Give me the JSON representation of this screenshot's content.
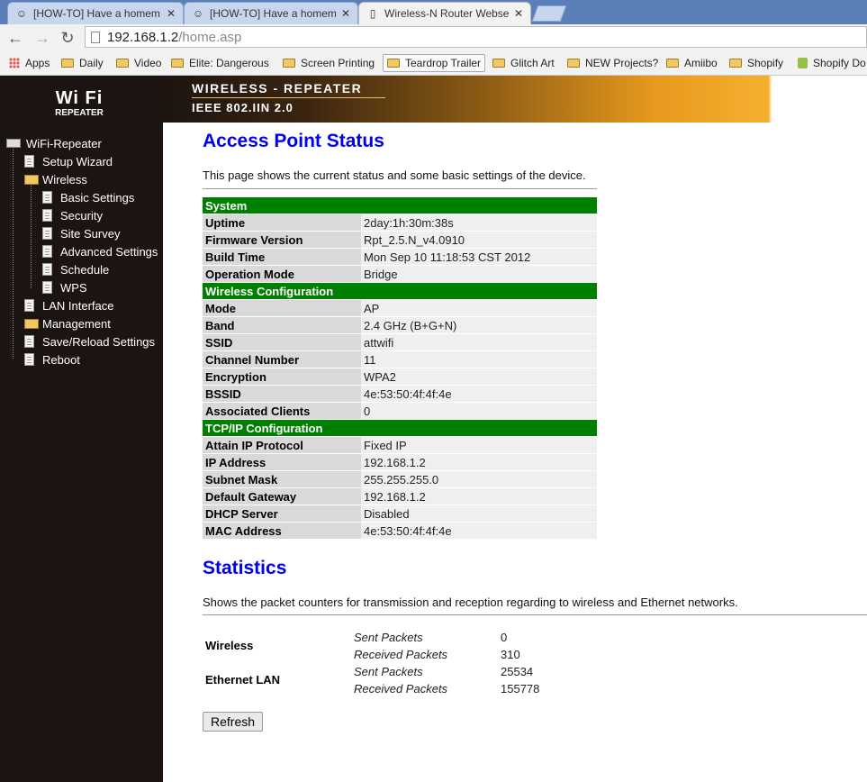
{
  "browser": {
    "tabs": [
      {
        "title": "[HOW-TO] Have a homem",
        "active": false
      },
      {
        "title": "[HOW-TO] Have a homem",
        "active": false
      },
      {
        "title": "Wireless-N Router Webse",
        "active": true
      }
    ],
    "url_host": "192.168.1.2",
    "url_path": "/home.asp",
    "bookmarks": [
      "Apps",
      "Daily",
      "Video",
      "Elite: Dangerous",
      "Screen Printing",
      "Teardrop Trailer",
      "Glitch Art",
      "NEW Projects?",
      "Amiibo",
      "Shopify",
      "Shopify Do"
    ]
  },
  "banner": {
    "logo_wifi": "Wi Fi",
    "logo_sub": "REPEATER",
    "line1": "WIRELESS - REPEATER",
    "line2": "IEEE 802.IIN 2.0"
  },
  "nav": {
    "root": "WiFi-Repeater",
    "setup_wizard": "Setup Wizard",
    "wireless": "Wireless",
    "basic_settings": "Basic Settings",
    "security": "Security",
    "site_survey": "Site Survey",
    "advanced_settings": "Advanced Settings",
    "schedule": "Schedule",
    "wps": "WPS",
    "lan_interface": "LAN Interface",
    "management": "Management",
    "save_reload": "Save/Reload Settings",
    "reboot": "Reboot"
  },
  "status": {
    "title": "Access Point Status",
    "description": "This page shows the current status and some basic settings of the device.",
    "system": {
      "header": "System",
      "uptime_label": "Uptime",
      "uptime": "2day:1h:30m:38s",
      "firmware_label": "Firmware Version",
      "firmware": "Rpt_2.5.N_v4.0910",
      "build_label": "Build Time",
      "build": "Mon Sep 10 11:18:53 CST 2012",
      "opmode_label": "Operation Mode",
      "opmode": "Bridge"
    },
    "wireless": {
      "header": "Wireless Configuration",
      "mode_label": "Mode",
      "mode": "AP",
      "band_label": "Band",
      "band": "2.4 GHz (B+G+N)",
      "ssid_label": "SSID",
      "ssid": "attwifi",
      "channel_label": "Channel Number",
      "channel": "11",
      "encryption_label": "Encryption",
      "encryption": "WPA2",
      "bssid_label": "BSSID",
      "bssid": "4e:53:50:4f:4f:4e",
      "clients_label": "Associated Clients",
      "clients": "0"
    },
    "tcpip": {
      "header": "TCP/IP Configuration",
      "protocol_label": "Attain IP Protocol",
      "protocol": "Fixed IP",
      "ip_label": "IP Address",
      "ip": "192.168.1.2",
      "mask_label": "Subnet Mask",
      "mask": "255.255.255.0",
      "gateway_label": "Default Gateway",
      "gateway": "192.168.1.2",
      "dhcp_label": "DHCP Server",
      "dhcp": "Disabled",
      "mac_label": "MAC Address",
      "mac": "4e:53:50:4f:4f:4e"
    }
  },
  "statistics": {
    "title": "Statistics",
    "description": "Shows the packet counters for transmission and reception regarding to wireless and Ethernet networks.",
    "wireless_label": "Wireless",
    "ethernet_label": "Ethernet LAN",
    "sent_label": "Sent Packets",
    "received_label": "Received Packets",
    "wireless_sent": "0",
    "wireless_received": "310",
    "ethernet_sent": "25534",
    "ethernet_received": "155778",
    "refresh": "Refresh"
  }
}
